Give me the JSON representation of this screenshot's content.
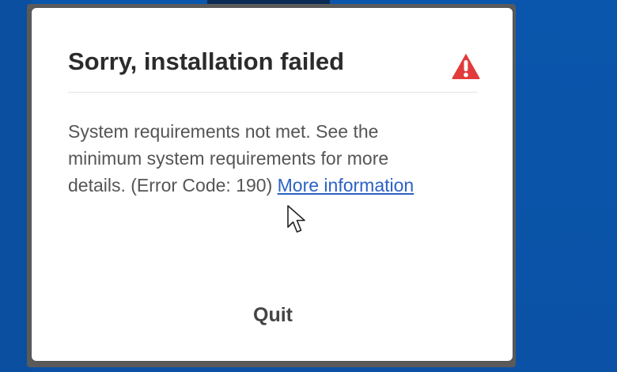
{
  "dialog": {
    "title": "Sorry, installation failed",
    "warning_icon": "warning-triangle-icon",
    "message": {
      "text": "System requirements not met. See the minimum system requirements for more details. (Error Code: 190) ",
      "link_text": "More information"
    },
    "quit_label": "Quit"
  },
  "colors": {
    "background": "#0b55aa",
    "dialog_background": "#ffffff",
    "warning": "#e03a3a",
    "link": "#2b62c6"
  }
}
